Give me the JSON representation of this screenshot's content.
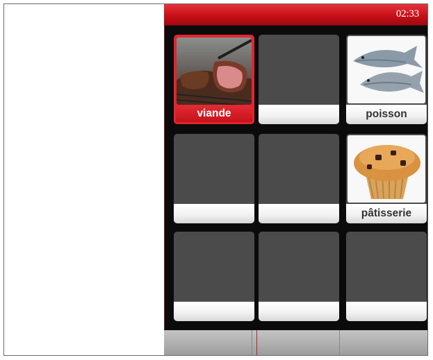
{
  "status_bar": {
    "time": "02:33"
  },
  "grid": {
    "tiles": [
      {
        "label": "viande",
        "image": "meat-image",
        "selected": true
      },
      {
        "label": "",
        "image": "",
        "selected": false
      },
      {
        "label": "poisson",
        "image": "fish-image",
        "selected": false
      },
      {
        "label": "",
        "image": "",
        "selected": false
      },
      {
        "label": "",
        "image": "",
        "selected": false
      },
      {
        "label": "pâtisserie",
        "image": "muffin-image",
        "selected": false
      },
      {
        "label": "",
        "image": "",
        "selected": false
      },
      {
        "label": "",
        "image": "",
        "selected": false
      },
      {
        "label": "",
        "image": "",
        "selected": false
      }
    ]
  },
  "softkeys": [
    "",
    "",
    ""
  ],
  "colors": {
    "accent": "#d0121c",
    "tile": "#4b4b4b",
    "background": "#0b0b0b"
  }
}
